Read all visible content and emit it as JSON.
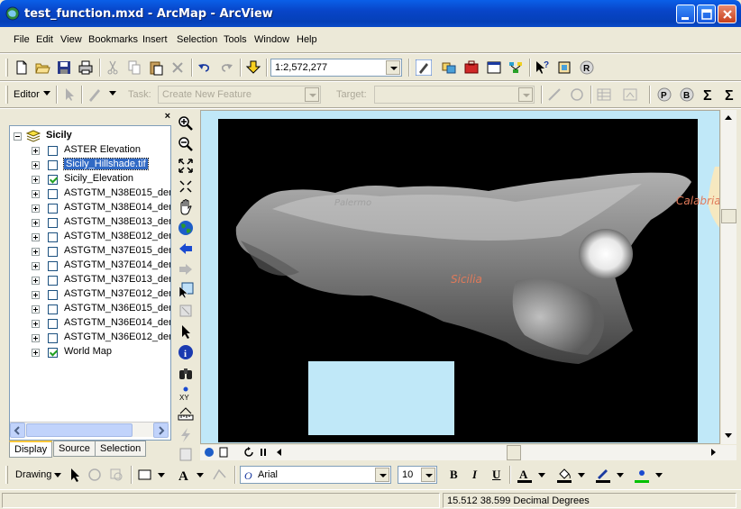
{
  "window": {
    "title": "test_function.mxd - ArcMap - ArcView"
  },
  "menu": [
    "File",
    "Edit",
    "View",
    "Bookmarks",
    "Insert",
    "Selection",
    "Tools",
    "Window",
    "Help"
  ],
  "standard_toolbar": {
    "scale": "1:2,572,277"
  },
  "editor_toolbar": {
    "editor_label": "Editor",
    "task_label": "Task:",
    "task_value": "Create New Feature",
    "target_label": "Target:",
    "target_value": ""
  },
  "toc": {
    "close_glyph": "×",
    "root": "Sicily",
    "layers": [
      {
        "name": "ASTER Elevation",
        "checked": false,
        "selected": false
      },
      {
        "name": "Sicily_Hillshade.tif",
        "checked": false,
        "selected": true
      },
      {
        "name": "Sicily_Elevation",
        "checked": true,
        "selected": false
      },
      {
        "name": "ASTGTM_N38E015_der",
        "checked": false,
        "selected": false
      },
      {
        "name": "ASTGTM_N38E014_der",
        "checked": false,
        "selected": false
      },
      {
        "name": "ASTGTM_N38E013_der",
        "checked": false,
        "selected": false
      },
      {
        "name": "ASTGTM_N38E012_der",
        "checked": false,
        "selected": false
      },
      {
        "name": "ASTGTM_N37E015_der",
        "checked": false,
        "selected": false
      },
      {
        "name": "ASTGTM_N37E014_der",
        "checked": false,
        "selected": false
      },
      {
        "name": "ASTGTM_N37E013_der",
        "checked": false,
        "selected": false
      },
      {
        "name": "ASTGTM_N37E012_der",
        "checked": false,
        "selected": false
      },
      {
        "name": "ASTGTM_N36E015_der",
        "checked": false,
        "selected": false
      },
      {
        "name": "ASTGTM_N36E014_der",
        "checked": false,
        "selected": false
      },
      {
        "name": "ASTGTM_N36E012_der",
        "checked": false,
        "selected": false
      },
      {
        "name": "World Map",
        "checked": true,
        "selected": false
      }
    ],
    "tabs": [
      "Display",
      "Source",
      "Selection"
    ]
  },
  "map": {
    "labels": {
      "sicilia": "Sicilia",
      "calabria": "Calabria",
      "palermo": "Palermo"
    }
  },
  "drawing_toolbar": {
    "drawing_label": "Drawing",
    "font": "Arial",
    "font_size": "10",
    "bold": "B",
    "italic": "I",
    "underline": "U"
  },
  "status": {
    "coordinates": "15.512  38.599 Decimal Degrees"
  },
  "colors": {
    "title_bar": "#0A5FE8",
    "sea": "#C0E8F8",
    "selection": "#316AC5",
    "map_label": "#E07A5A"
  }
}
